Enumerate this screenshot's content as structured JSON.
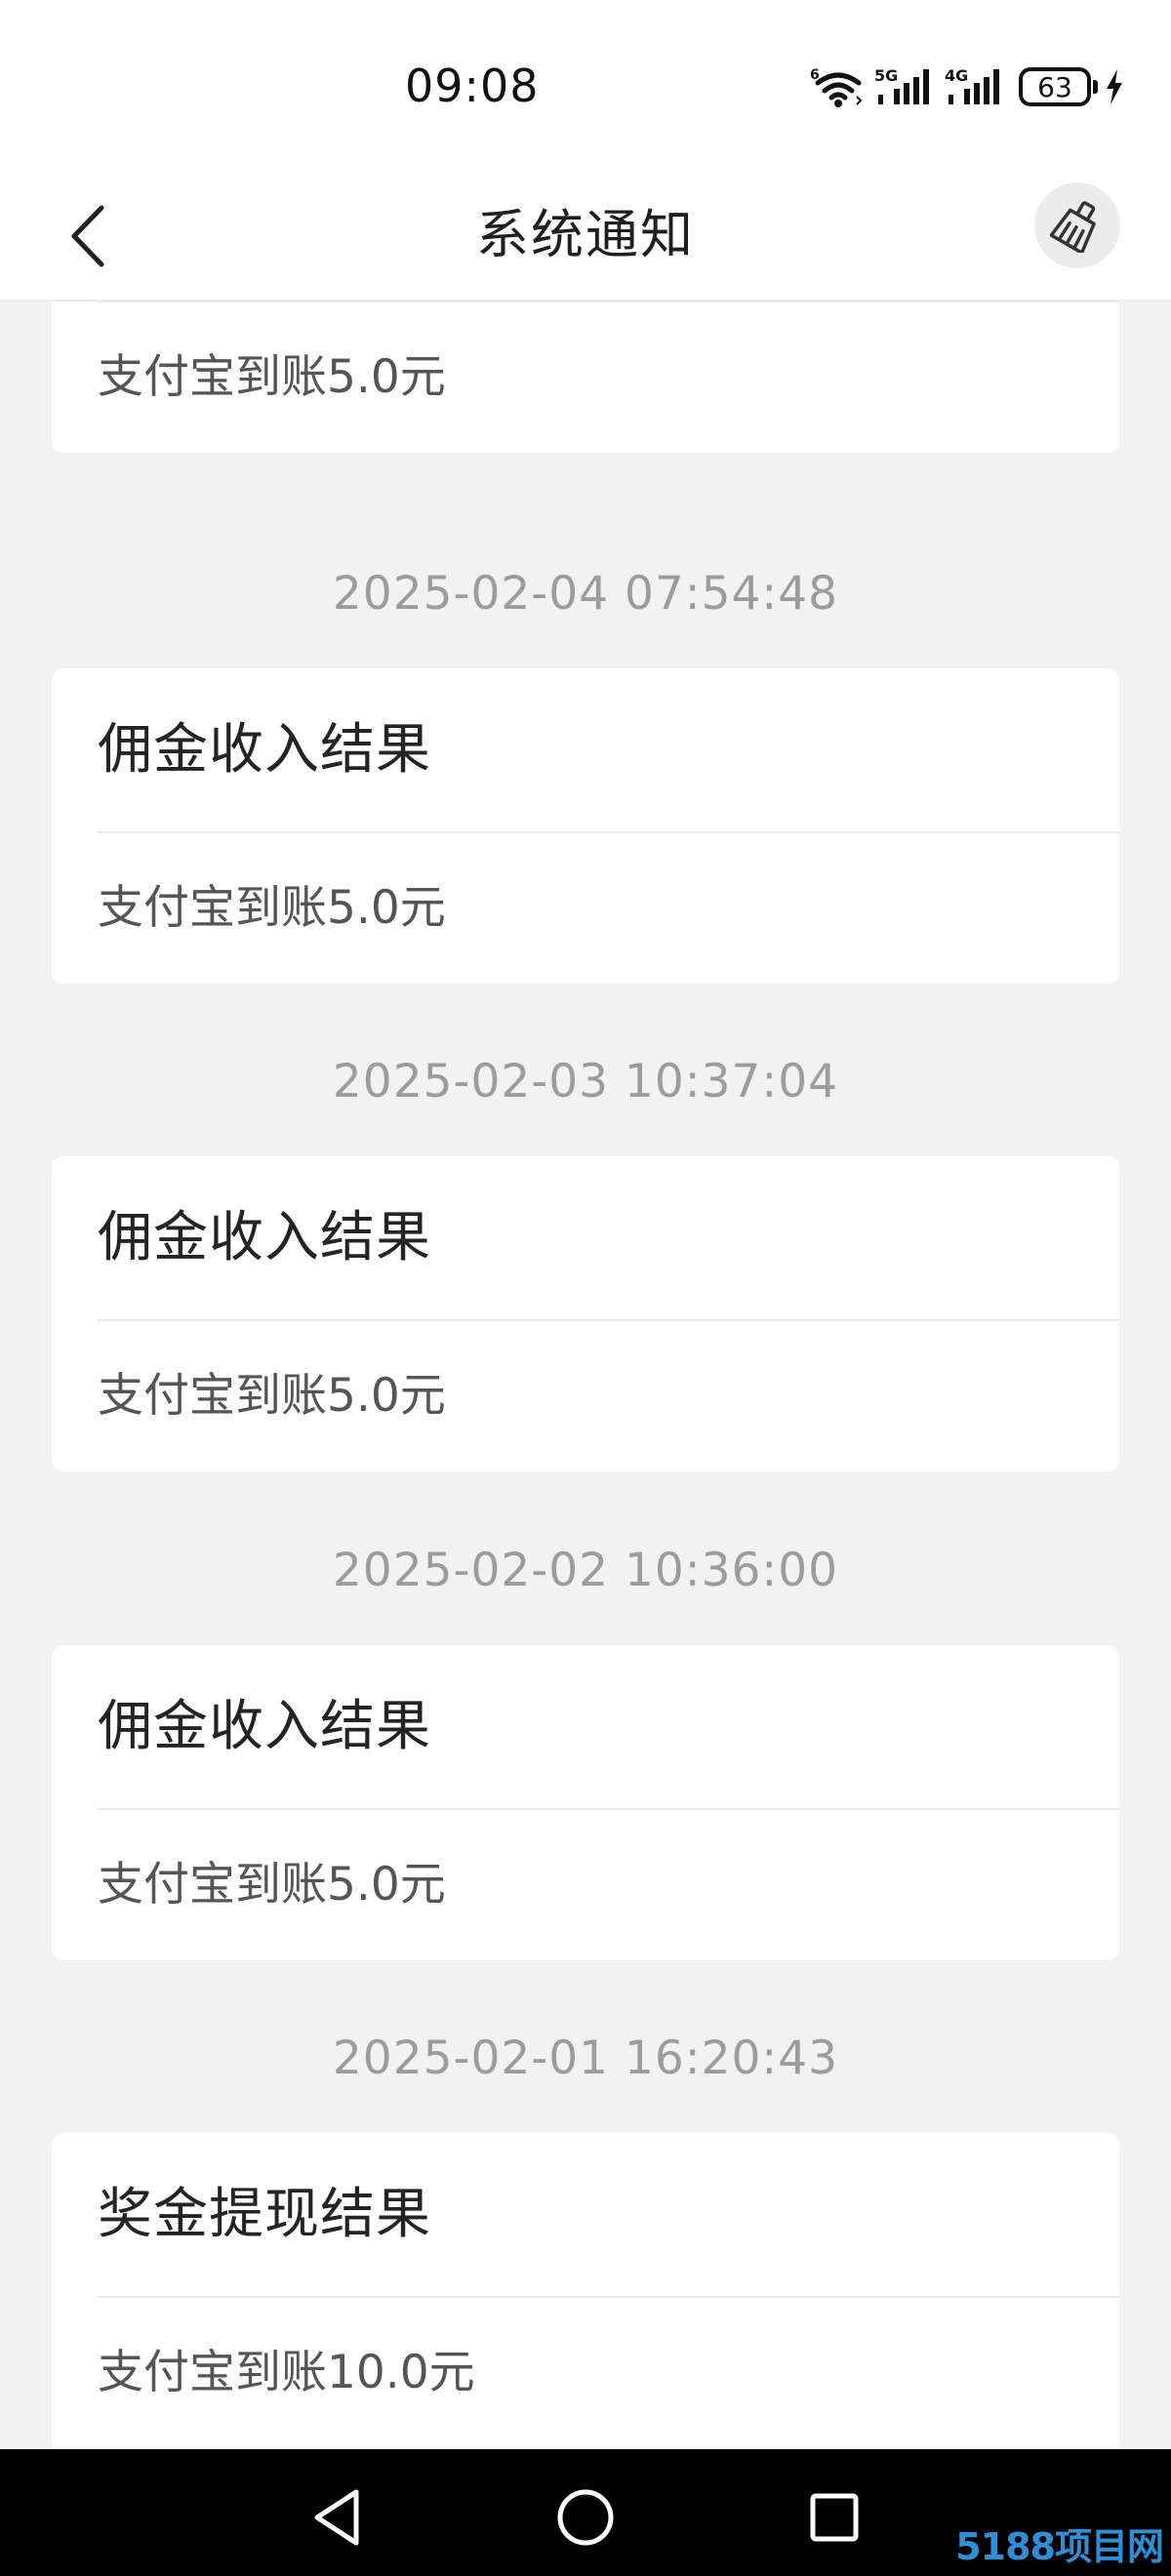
{
  "status_bar": {
    "time": "09:08",
    "battery_level": "63",
    "signal_5g_label": "5G",
    "signal_4g_label": "4G",
    "wifi_label": "6"
  },
  "header": {
    "title": "系统通知",
    "back_icon": "chevron-left-icon",
    "clear_icon": "broom-icon"
  },
  "notifications": [
    {
      "timestamp": "",
      "title": "",
      "body": "支付宝到账5.0元"
    },
    {
      "timestamp": "2025-02-04 07:54:48",
      "title": "佣金收入结果",
      "body": "支付宝到账5.0元"
    },
    {
      "timestamp": "2025-02-03 10:37:04",
      "title": "佣金收入结果",
      "body": "支付宝到账5.0元"
    },
    {
      "timestamp": "2025-02-02 10:36:00",
      "title": "佣金收入结果",
      "body": "支付宝到账5.0元"
    },
    {
      "timestamp": "2025-02-01 16:20:43",
      "title": "奖金提现结果",
      "body": "支付宝到账10.0元"
    }
  ],
  "nav_bar": {
    "back_icon": "triangle-back-icon",
    "home_icon": "circle-home-icon",
    "recents_icon": "square-recents-icon"
  },
  "watermark": "5188项目网"
}
